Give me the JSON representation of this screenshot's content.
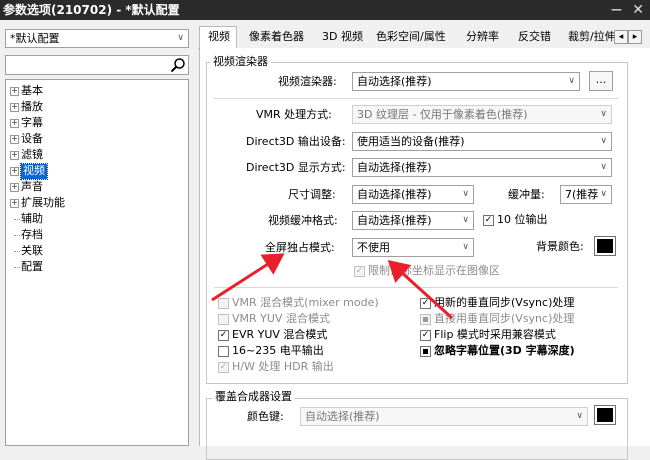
{
  "window": {
    "title": "参数选项(210702) - *默认配置",
    "pin": "—",
    "close": "✕"
  },
  "profile": {
    "value": "*默认配置"
  },
  "search": {
    "value": ""
  },
  "tree": [
    {
      "label": "基本",
      "exp": "+"
    },
    {
      "label": "播放",
      "exp": "+"
    },
    {
      "label": "字幕",
      "exp": "+"
    },
    {
      "label": "设备",
      "exp": "+"
    },
    {
      "label": "滤镜",
      "exp": "+"
    },
    {
      "label": "视频",
      "exp": "+",
      "selected": true
    },
    {
      "label": "声音",
      "exp": "+"
    },
    {
      "label": "扩展功能",
      "exp": "+"
    },
    {
      "label": "辅助",
      "exp": ""
    },
    {
      "label": "存档",
      "exp": ""
    },
    {
      "label": "关联",
      "exp": ""
    },
    {
      "label": "配置",
      "exp": ""
    }
  ],
  "tabs": [
    "视频",
    "像素着色器",
    "3D 视频",
    "色彩空间/属性",
    "分辨率",
    "反交错",
    "裁剪/拉伸"
  ],
  "tab_scroll": {
    "left": "◂",
    "right": "▸"
  },
  "renderer": {
    "group_title": "视频渲染器",
    "renderer_label": "视频渲染器:",
    "renderer_value": "自动选择(推荐)",
    "more_button": "...",
    "vmr_mode_label": "VMR 处理方式:",
    "vmr_mode_value": "3D 纹理层 - 仅用于像素着色(推荐)",
    "d3d_device_label": "Direct3D 输出设备:",
    "d3d_device_value": "使用适当的设备(推荐)",
    "d3d_display_label": "Direct3D 显示方式:",
    "d3d_display_value": "自动选择(推荐)",
    "resize_label": "尺寸调整:",
    "resize_value": "自动选择(推荐)",
    "buffer_label": "缓冲量:",
    "buffer_value": "7(推荐",
    "buffer_format_label": "视频缓冲格式:",
    "buffer_format_value": "自动选择(推荐)",
    "tenbit_label": "10 位输出",
    "fullscreen_label": "全屏独占模式:",
    "fullscreen_value": "不使用",
    "bg_color_label": "背景颜色:",
    "limit_mouse_label": "限制鼠标坐标显示在图像区"
  },
  "options_left": [
    {
      "label": "VMR 混合模式(mixer mode)",
      "state": "unchecked",
      "disabled": true
    },
    {
      "label": "VMR YUV 混合模式",
      "state": "unchecked",
      "disabled": true
    },
    {
      "label": "EVR YUV 混合模式",
      "state": "checked",
      "disabled": false
    },
    {
      "label": "16~235 电平输出",
      "state": "unchecked",
      "disabled": false
    },
    {
      "label": "H/W 处理 HDR 输出",
      "state": "checked",
      "disabled": true
    }
  ],
  "options_right": [
    {
      "label": "用新的垂直同步(Vsync)处理",
      "state": "checked",
      "disabled": false
    },
    {
      "label": "直接用垂直同步(Vsync)处理",
      "state": "indeterminate",
      "disabled": true
    },
    {
      "label": "Flip 模式时采用兼容模式",
      "state": "checked",
      "disabled": false
    },
    {
      "label": "忽略字幕位置(3D 字幕深度)",
      "state": "indeterminate",
      "disabled": false
    }
  ],
  "overlay": {
    "group_title": "覆盖合成器设置",
    "color_key_label": "颜色键:",
    "color_key_value": "自动选择(推荐)"
  },
  "check_mark": "✓",
  "colors": {
    "titlebar": "#2b2b2b",
    "arrow": "#e8202a",
    "swatch": "#000000",
    "selection": "#0a64d6"
  }
}
